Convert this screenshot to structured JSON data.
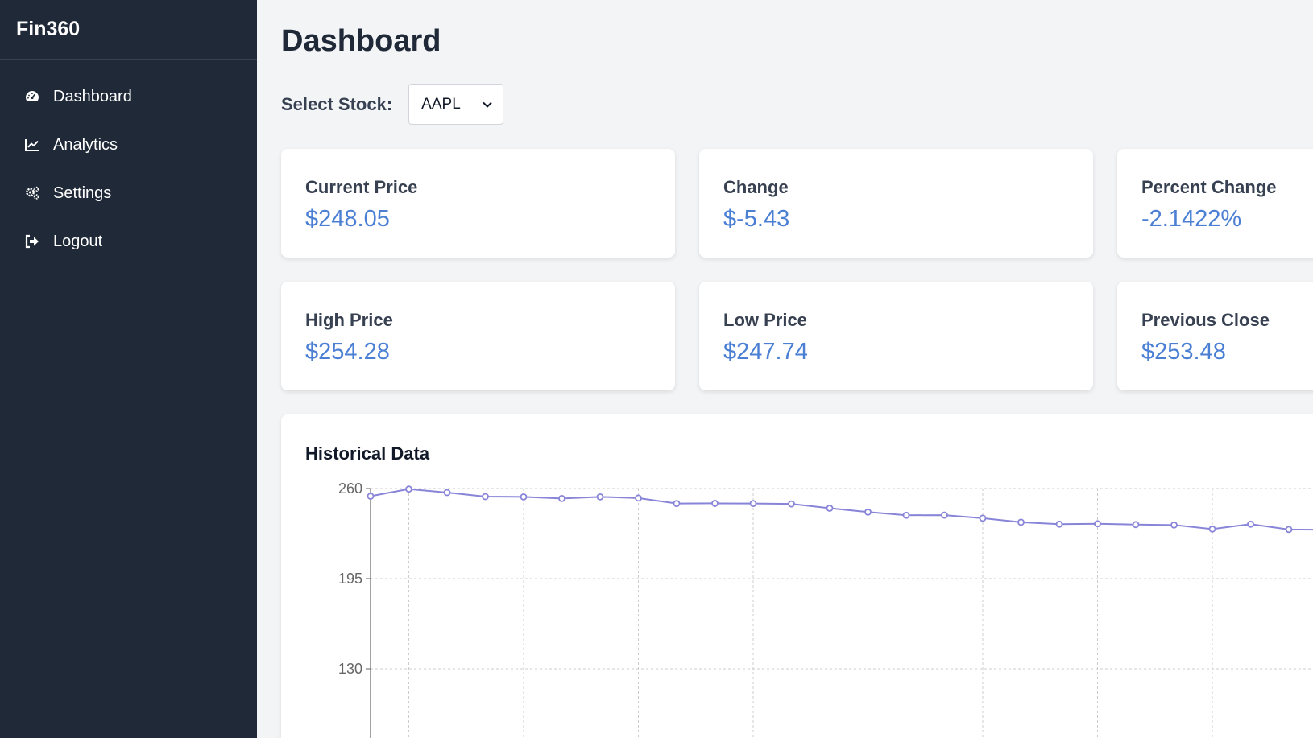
{
  "sidebar": {
    "brand": "Fin360",
    "items": [
      {
        "label": "Dashboard",
        "icon": "gauge-icon"
      },
      {
        "label": "Analytics",
        "icon": "chart-line-icon"
      },
      {
        "label": "Settings",
        "icon": "gears-icon"
      },
      {
        "label": "Logout",
        "icon": "sign-out-icon"
      }
    ]
  },
  "main": {
    "title": "Dashboard",
    "select_label": "Select Stock:",
    "selected_stock": "AAPL"
  },
  "cards": [
    {
      "label": "Current Price",
      "value": "$248.05"
    },
    {
      "label": "Change",
      "value": "$-5.43"
    },
    {
      "label": "Percent Change",
      "value": "-2.1422%"
    },
    {
      "label": "High Price",
      "value": "$254.28"
    },
    {
      "label": "Low Price",
      "value": "$247.74"
    },
    {
      "label": "Previous Close",
      "value": "$253.48"
    }
  ],
  "chart_section": {
    "title": "Historical Data"
  },
  "colors": {
    "sidebar_bg": "#1f2937",
    "accent_value": "#4a7fd4",
    "line": "#8884d8"
  },
  "chart_data": {
    "type": "line",
    "title": "Historical Data",
    "xlabel": "",
    "ylabel": "",
    "yticks": [
      "260",
      "195",
      "130"
    ],
    "ylim": [
      65,
      260
    ],
    "grid": true,
    "series": [
      {
        "values": [
          254.5,
          259.6,
          257.1,
          254.2,
          254.0,
          252.8,
          254.0,
          253.1,
          249.2,
          249.3,
          249.2,
          248.9,
          245.8,
          243.0,
          240.7,
          240.8,
          238.6,
          235.7,
          234.3,
          234.6,
          234.0,
          233.7,
          230.8,
          234.3,
          230.5,
          230.2
        ]
      }
    ]
  }
}
